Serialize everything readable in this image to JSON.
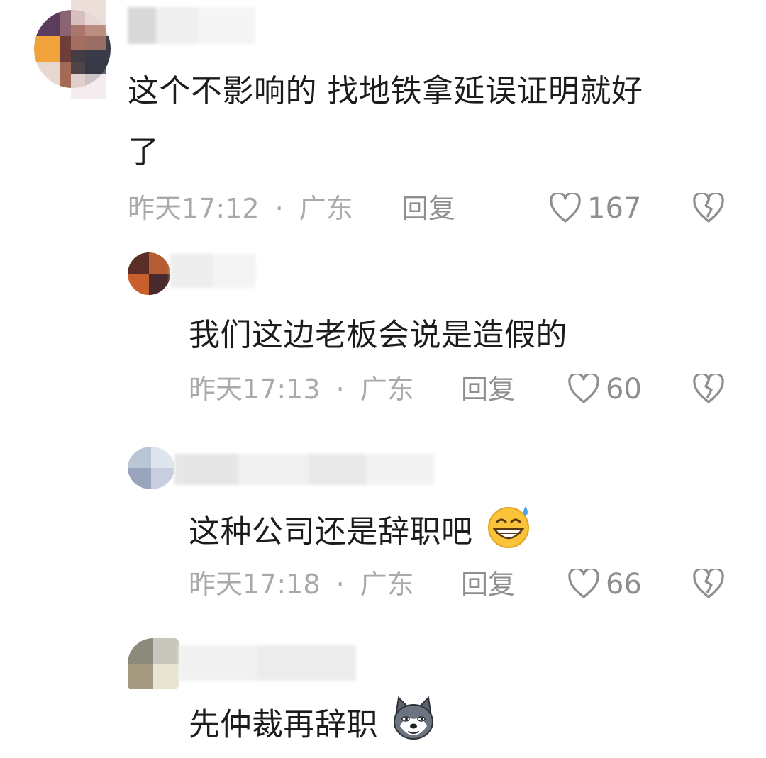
{
  "comments": [
    {
      "text_line1": "这个不影响的 找地铁拿延误证明就好",
      "text_line2": "了",
      "time": "昨天17:12",
      "sep": "·",
      "location": "广东",
      "reply_label": "回复",
      "likes": "167"
    },
    {
      "text": "我们这边老板会说是造假的",
      "time": "昨天17:13",
      "sep": "·",
      "location": "广东",
      "reply_label": "回复",
      "likes": "60"
    },
    {
      "text": "这种公司还是辞职吧",
      "emoji": "sweat-smile-emoji",
      "time": "昨天17:18",
      "sep": "·",
      "location": "广东",
      "reply_label": "回复",
      "likes": "66"
    },
    {
      "text": "先仲裁再辞职",
      "emoji": "husky-dog-emoji"
    }
  ],
  "colors": {
    "meta": "#a9a9a9",
    "action": "#8e8e8e",
    "text": "#1c1c1c"
  },
  "icons": [
    "heart-icon",
    "broken-heart-icon"
  ]
}
